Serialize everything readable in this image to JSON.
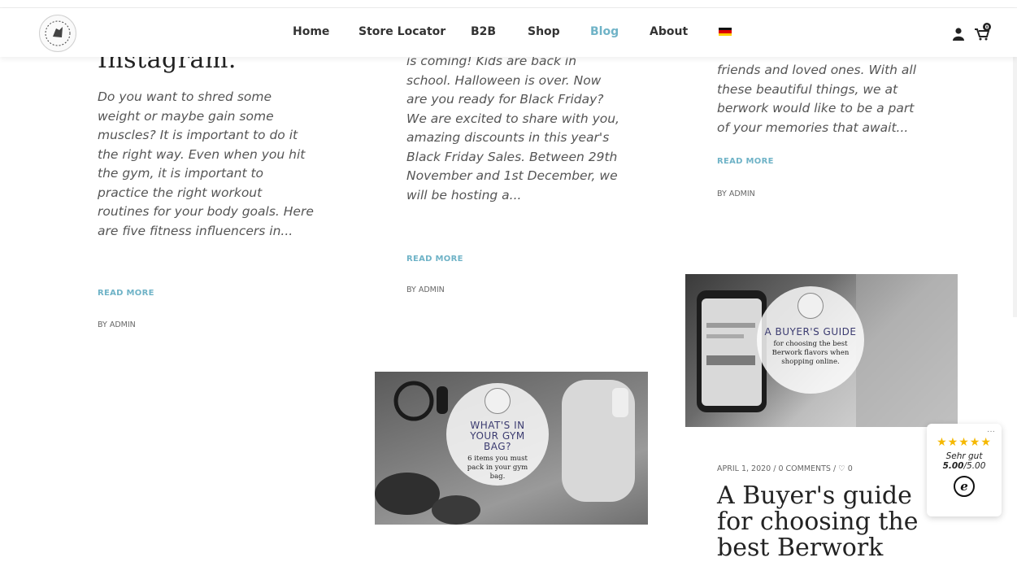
{
  "nav": {
    "items": [
      {
        "label": "Home",
        "active": false
      },
      {
        "label": "Store Locator",
        "active": false
      },
      {
        "label": "B2B",
        "active": false
      },
      {
        "label": "Shop",
        "active": false
      },
      {
        "label": "Blog",
        "active": true
      },
      {
        "label": "About",
        "active": false
      }
    ],
    "cart_count": "0",
    "accent_color": "#6fb3c7"
  },
  "posts": {
    "col1": {
      "title_partial": "Instagram.",
      "excerpt": "Do you want to shred some weight or maybe gain some muscles? It is important to do it the right way. Even when you hit the gym, it is important to practice the right workout routines for your body goals. Here are five fitness influencers in...",
      "read_more": "READ MORE",
      "author": "BY ADMIN"
    },
    "col2": {
      "excerpt": "is coming! Kids are back in school. Halloween is over. Now are you ready for Black Friday? We are excited to share with you, amazing discounts in this year's Black Friday Sales. Between 29th November and 1st December, we will be hosting a...",
      "read_more": "READ MORE",
      "author": "BY ADMIN"
    },
    "col3": {
      "excerpt": "friends and loved ones. With all these beautiful things, we at berwork would like to be a part of your memories that await...",
      "read_more": "READ MORE",
      "author": "BY ADMIN"
    },
    "gym_bag": {
      "image_title": "WHAT'S IN YOUR GYM BAG?",
      "image_subtitle": "6 items you must pack in your gym bag."
    },
    "buyers_guide": {
      "image_title": "A BUYER'S GUIDE",
      "image_subtitle": "for choosing the best Berwork flavors when shopping online.",
      "meta": "APRIL 1, 2020 / 0 COMMENTS / ♡ 0",
      "title": "A Buyer's guide for choosing the best Berwork"
    }
  },
  "trusted": {
    "stars": "★★★★★",
    "label": "Sehr gut",
    "score": "5.00",
    "max": "/5.00",
    "logo": "e",
    "menu": "···"
  }
}
